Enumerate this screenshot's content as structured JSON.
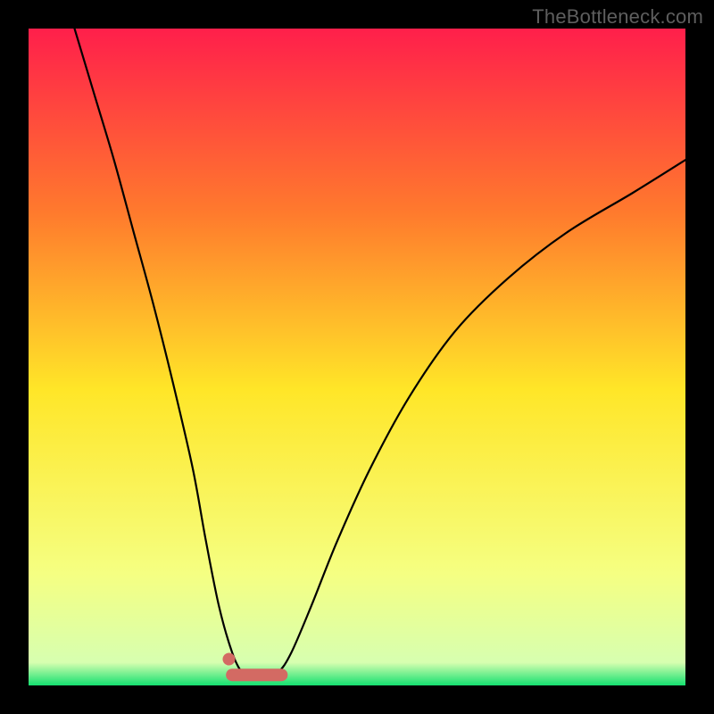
{
  "watermark": "TheBottleneck.com",
  "colors": {
    "frame": "#000000",
    "gradient_top": "#ff1f4b",
    "gradient_mid_upper": "#ff7a2d",
    "gradient_mid": "#ffe628",
    "gradient_lower": "#f5ff82",
    "gradient_bottom": "#14e070",
    "curve": "#000000",
    "marker": "#d36a63",
    "marker_dot": "#d36a63"
  },
  "chart_data": {
    "type": "line",
    "title": "",
    "xlabel": "",
    "ylabel": "",
    "xlim": [
      0,
      100
    ],
    "ylim": [
      0,
      100
    ],
    "note": "Bottleneck-style curve: y-values are approximate % readouts from the gradient scale (0 at bottom/green, 100 at top/red).",
    "series": [
      {
        "name": "bottleneck-curve",
        "x": [
          7,
          10,
          13,
          16,
          19,
          22,
          25,
          27,
          29,
          31,
          32.5,
          34,
          36,
          38,
          40,
          43,
          47,
          52,
          58,
          65,
          73,
          82,
          92,
          100
        ],
        "y": [
          100,
          90,
          80,
          69,
          58,
          46,
          33,
          22,
          12,
          5,
          2,
          1.5,
          1.5,
          2,
          5,
          12,
          22,
          33,
          44,
          54,
          62,
          69,
          75,
          80
        ]
      }
    ],
    "markers": [
      {
        "name": "valley-band-left-dot",
        "x": 30.5,
        "y": 4
      },
      {
        "name": "valley-band",
        "x_start": 31,
        "x_end": 38.5,
        "y": 1.6
      }
    ]
  }
}
